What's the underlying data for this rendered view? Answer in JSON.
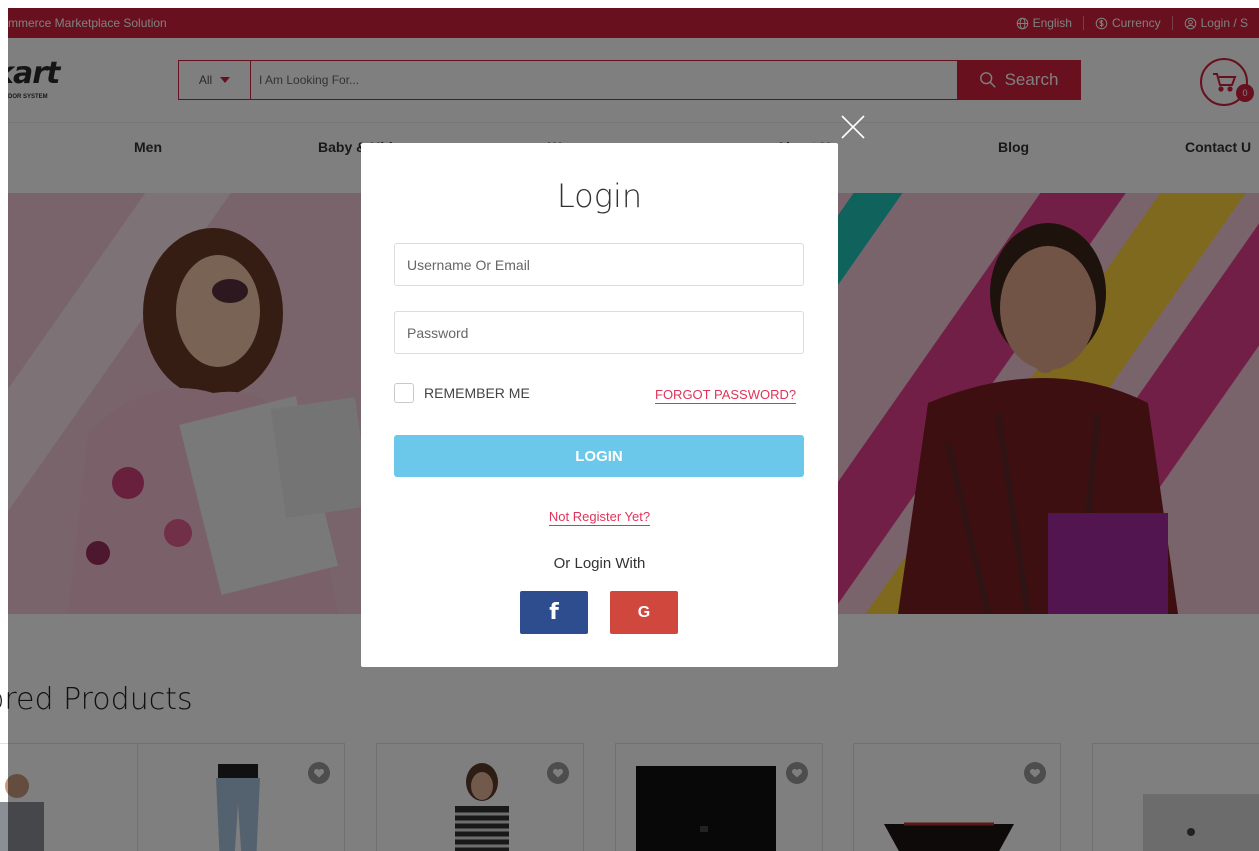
{
  "topbar": {
    "tagline": "mmerce Marketplace Solution",
    "language": "English",
    "currency": "Currency",
    "login": "Login / S"
  },
  "header": {
    "logo_text": "kart",
    "logo_sub": "DOR SYSTEM",
    "category_selected": "All",
    "search_placeholder": "I Am Looking For...",
    "search_button": "Search",
    "cart_count": "0"
  },
  "nav": {
    "items": [
      "Men",
      "Baby & Kids",
      "Women",
      "About Us",
      "Blog",
      "Contact U"
    ]
  },
  "products": {
    "title": "ored Products"
  },
  "modal": {
    "title": "Login",
    "username_placeholder": "Username Or Email",
    "password_placeholder": "Password",
    "remember_label": "REMEMBER ME",
    "forgot_label": "FORGOT PASSWORD?",
    "login_button": "LOGIN",
    "register_link": "Not Register Yet?",
    "or_login_with": "Or Login With",
    "facebook_label": "f",
    "google_label": "G"
  },
  "colors": {
    "brand": "#d1203d",
    "login_button": "#6cc8ea",
    "link": "#e0335a",
    "facebook": "#2e4d8f",
    "google": "#d0473d"
  },
  "icons": [
    "globe-icon",
    "currency-icon",
    "user-icon",
    "search-icon",
    "cart-icon",
    "close-icon",
    "heart-icon"
  ]
}
